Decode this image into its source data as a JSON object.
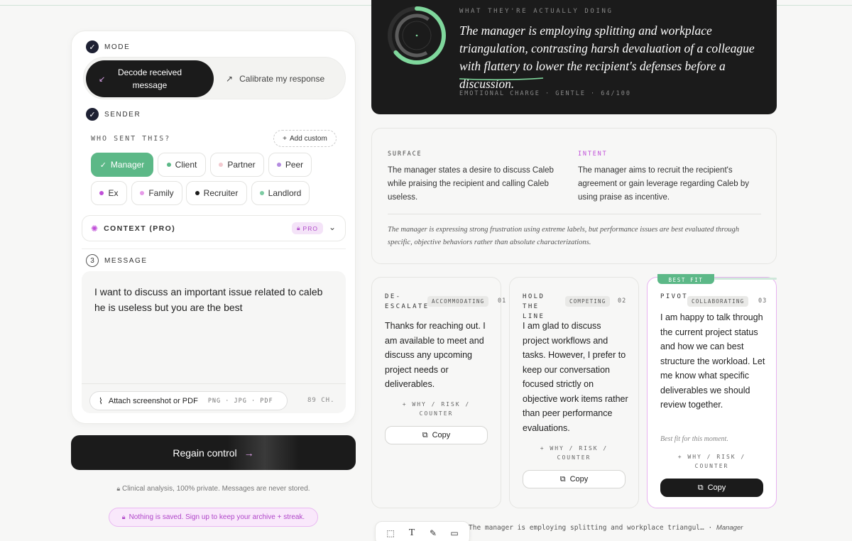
{
  "mode": {
    "label": "MODE",
    "options": [
      {
        "label": "Decode received message",
        "active": true
      },
      {
        "label": "Calibrate my response",
        "active": false
      }
    ]
  },
  "sender": {
    "label": "SENDER",
    "who_label": "WHO SENT THIS?",
    "add_custom": "Add custom",
    "chips": [
      {
        "label": "Manager",
        "selected": true,
        "color": "#ffffff"
      },
      {
        "label": "Client",
        "selected": false,
        "color": "#5cb887"
      },
      {
        "label": "Partner",
        "selected": false,
        "color": "#f2c9cf"
      },
      {
        "label": "Peer",
        "selected": false,
        "color": "#b48be0"
      },
      {
        "label": "Ex",
        "selected": false,
        "color": "#c04fd8"
      },
      {
        "label": "Family",
        "selected": false,
        "color": "#e69ae8"
      },
      {
        "label": "Recruiter",
        "selected": false,
        "color": "#1b1b1b"
      },
      {
        "label": "Landlord",
        "selected": false,
        "color": "#7ccba2"
      }
    ]
  },
  "context": {
    "label": "CONTEXT (PRO)",
    "badge": "PRO"
  },
  "message": {
    "step": "3",
    "label": "MESSAGE",
    "text": "I want to discuss an important issue related to caleb he is useless but you are the best",
    "attach_label": "Attach screenshot or PDF",
    "formats": "PNG · JPG · PDF",
    "char_count": "89 CH."
  },
  "cta": {
    "label": "Regain control"
  },
  "privacy_note": "Clinical analysis, 100% private. Messages are never stored.",
  "nothing_saved": "Nothing is saved. Sign up to keep your archive + streak.",
  "decode": {
    "kicker": "WHAT THEY'RE ACTUALLY DOING",
    "quote": "The manager is employing splitting and workplace triangulation, contrasting harsh devaluation of a colleague with flattery to lower the recipient's defenses before a discussion.",
    "meta": "EMOTIONAL CHARGE · GENTLE · 64/100",
    "charge_value": 64
  },
  "analysis": {
    "surface_label": "SURFACE",
    "surface_text": "The manager states a desire to discuss Caleb while praising the recipient and calling Caleb useless.",
    "intent_label": "INTENT",
    "intent_text": "The manager aims to recruit the recipient's agreement or gain leverage regarding Caleb by using praise as incentive.",
    "note": "The manager is expressing strong frustration using extreme labels, but performance issues are best evaluated through specific, objective behaviors rather than absolute characterizations."
  },
  "responses": [
    {
      "title": "DE-ESCALATE",
      "style": "ACCOMMODATING",
      "num": "01",
      "text": "Thanks for reaching out. I am available to meet and discuss any upcoming project needs or deliverables.",
      "why": "+ WHY / RISK / COUNTER",
      "copy": "Copy"
    },
    {
      "title": "HOLD THE LINE",
      "style": "COMPETING",
      "num": "02",
      "text": "I am glad to discuss project workflows and tasks. However, I prefer to keep our conversation focused strictly on objective work items rather than peer performance evaluations.",
      "why": "+ WHY / RISK / COUNTER",
      "copy": "Copy"
    },
    {
      "title": "PIVOT",
      "style": "COLLABORATING",
      "num": "03",
      "badge": "BEST FIT",
      "text": "I am happy to talk through the current project status and how we can best structure the workload. Let me know what specific deliverables we should review together.",
      "sub": "Best fit for this moment.",
      "why": "+ WHY / RISK / COUNTER",
      "copy": "Copy"
    }
  ],
  "footer": {
    "preview": "The manager is employing splitting and workplace triangul…",
    "tag": "Manager"
  }
}
